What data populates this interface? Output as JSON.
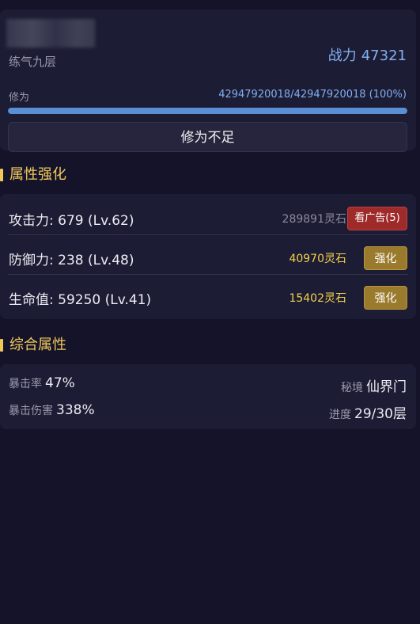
{
  "player": {
    "realm": "练气九层",
    "power_label": "战力",
    "power_value": "47321",
    "cultivation_label": "修为",
    "cultivation_value": "42947920018/42947920018 (100%)",
    "cultivation_progress": 1.0,
    "cultivate_button": "修为不足"
  },
  "attributes": {
    "title": "属性强化",
    "rows": [
      {
        "name": "攻击力: 679 (Lv.62)",
        "cost": "289891灵石",
        "action": "看广告(5)"
      },
      {
        "name": "防御力: 238 (Lv.48)",
        "cost": "40970灵石",
        "action": "强化"
      },
      {
        "name": "生命值: 59250 (Lv.41)",
        "cost": "15402灵石",
        "action": "强化"
      }
    ]
  },
  "summary": {
    "title": "综合属性",
    "crit_rate_label": "暴击率",
    "crit_rate_value": "47%",
    "crit_dmg_label": "暴击伤害",
    "crit_dmg_value": "338%",
    "secret_realm_label": "秘境",
    "secret_realm_value": "仙界门",
    "progress_label": "进度",
    "progress_value": "29/30层"
  },
  "colors": {
    "background": "#14132a",
    "card": "#1d1c35",
    "accent_blue": "#7fb0f0",
    "gold": "#f0c85a",
    "cost_gold": "#f2d34a",
    "ad_red": "#9e2a2a",
    "upgrade_gold": "#9a7a2c"
  }
}
